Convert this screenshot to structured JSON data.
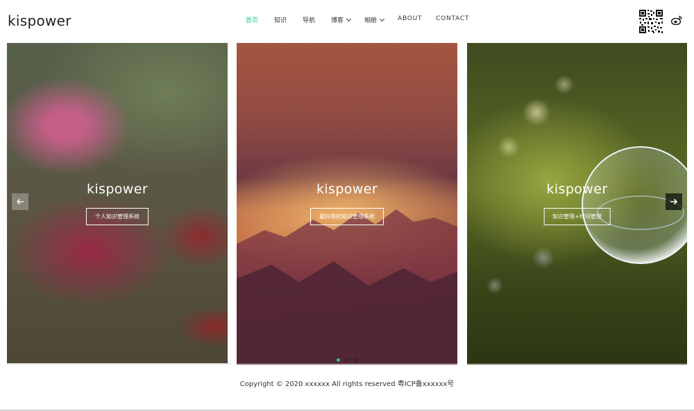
{
  "header": {
    "logo_text": "kispower",
    "nav": [
      {
        "label": "首页",
        "active": true
      },
      {
        "label": "知识"
      },
      {
        "label": "导航"
      },
      {
        "label": "博客",
        "dropdown": true
      },
      {
        "label": "相册",
        "dropdown": true
      },
      {
        "label": "ABOUT"
      },
      {
        "label": "CONTACT"
      }
    ],
    "accent_color": "#2dbf9a",
    "icons": [
      "qr-code-icon",
      "weibo-icon"
    ]
  },
  "slider": {
    "slides": [
      {
        "title": "kispower",
        "button": "个人知识管理系统"
      },
      {
        "title": "kispower",
        "button": "最好用的知识管理系统"
      },
      {
        "title": "kispower",
        "button": "知识管理+时间管理"
      }
    ],
    "prev_icon": "arrow-left-icon",
    "next_icon": "arrow-right-icon",
    "pagination": {
      "count": 3,
      "active_index": 0,
      "active_color": "#2dbf9a"
    },
    "scrollbar_progress": 0.33
  },
  "footer": {
    "copyright": "Copyright © 2020 xxxxxx All rights reserved 粤ICP备xxxxxx号"
  }
}
